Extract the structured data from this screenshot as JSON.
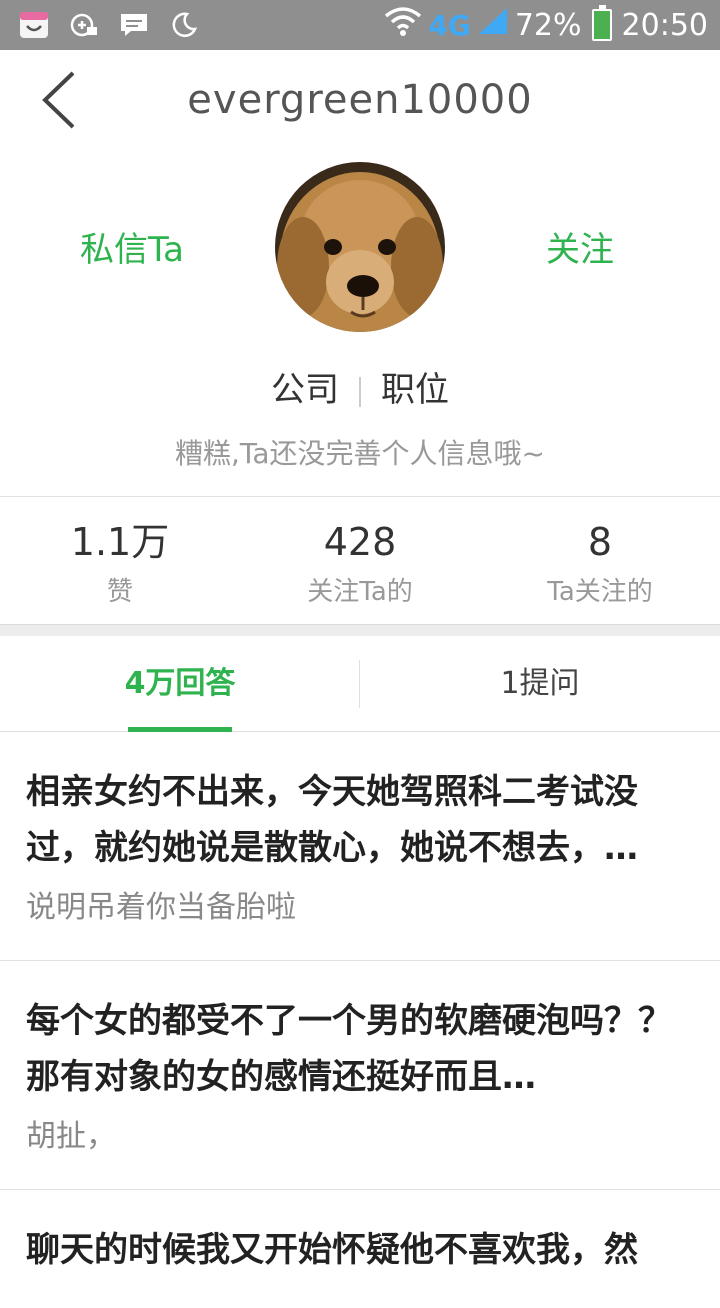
{
  "status": {
    "network": "4G",
    "battery": "72%",
    "time": "20:50"
  },
  "header": {
    "title": "evergreen10000"
  },
  "profile": {
    "message_label": "私信Ta",
    "follow_label": "关注",
    "company": "公司",
    "position": "职位",
    "bio": "糟糕,Ta还没完善个人信息哦~"
  },
  "stats": [
    {
      "value": "1.1万",
      "label": "赞"
    },
    {
      "value": "428",
      "label": "关注Ta的"
    },
    {
      "value": "8",
      "label": "Ta关注的"
    }
  ],
  "tabs": [
    {
      "label": "4万回答",
      "active": true
    },
    {
      "label": "1提问",
      "active": false
    }
  ],
  "answers": [
    {
      "question": "相亲女约不出来，今天她驾照科二考试没过，就约她说是散散心，她说不想去，…",
      "answer": "说明吊着你当备胎啦"
    },
    {
      "question": "每个女的都受不了一个男的软磨硬泡吗？？那有对象的女的感情还挺好而且…",
      "answer": "胡扯，"
    },
    {
      "question": "聊天的时候我又开始怀疑他不喜欢我，然",
      "answer": ""
    }
  ]
}
